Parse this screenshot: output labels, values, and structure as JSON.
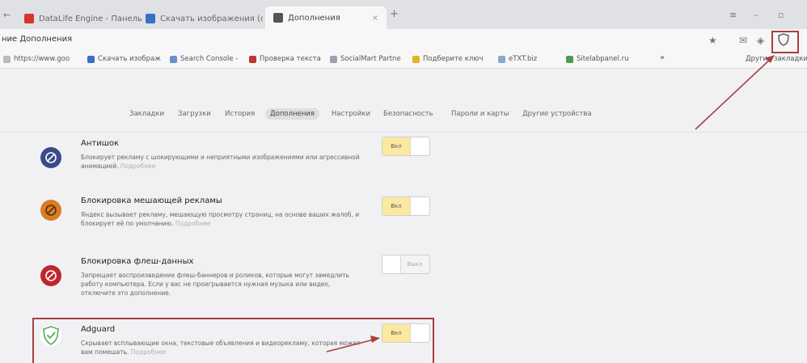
{
  "tabs": [
    {
      "label": "DataLife Engine - Панель",
      "fav_color": "#d9362b"
    },
    {
      "label": "Скачать изображения (скрин",
      "fav_color": "#3a6fc7"
    },
    {
      "label": "Дополнения",
      "fav_color": "#555555"
    }
  ],
  "tab_new": "+",
  "tab_close": "×",
  "window": {
    "menu": "≡",
    "minimize": "–",
    "maximize": "▫"
  },
  "address": {
    "text": "ние Дополнения"
  },
  "bookmarks": [
    {
      "label": "https://www.goo",
      "color": "#bbbbbb"
    },
    {
      "label": "Скачать изображ",
      "color": "#3a6fc7"
    },
    {
      "label": "Search Console -",
      "color": "#6a8fd1"
    },
    {
      "label": "Проверка текста",
      "color": "#c2362e"
    },
    {
      "label": "SocialMart Partne",
      "color": "#9aa3b0"
    },
    {
      "label": "Подберите ключ",
      "color": "#e6b229"
    },
    {
      "label": "eTXT.biz",
      "color": "#8aa8c8"
    },
    {
      "label": "Sitelabpanel.ru",
      "color": "#4e9a55"
    }
  ],
  "bookmarks_more": "»",
  "bookmarks_other": "Другие закладки",
  "nav": [
    "Закладки",
    "Загрузки",
    "История",
    "Дополнения",
    "Настройки",
    "Безопасность",
    "Пароли и карты",
    "Другие устройства"
  ],
  "extensions": [
    {
      "title": "Антишок",
      "desc": "Блокирует рекламу с шокирующими и неприятными изображениями или агрессивной анимацией.",
      "more": "Подробнее",
      "toggle": "Вкл",
      "on": true,
      "icon_color": "#3b4a8c"
    },
    {
      "title": "Блокировка мешающей рекламы",
      "desc": "Яндекс вызывает рекламу, мешающую просмотру страниц, на основе ваших жалоб, и блокирует её по умолчанию.",
      "more": "Подробнее",
      "toggle": "Вкл",
      "on": true,
      "icon_color": "#d77e22"
    },
    {
      "title": "Блокировка флеш-данных",
      "desc": "Запрещает воспроизведение флеш-баннеров и роликов, которые могут замедлить работу компьютера. Если у вас не проигрывается нужная музыка или видео, отключите это дополнение.",
      "more": "",
      "toggle": "Выкл",
      "on": false,
      "icon_color": "#c0272d"
    },
    {
      "title": "Adguard",
      "desc": "Скрывает всплывающие окна, текстовые объявления и видеорекламу, которая может вам помешать.",
      "more": "Подробнее",
      "toggle": "Вкл",
      "on": true,
      "icon_color": "#5aa85f"
    }
  ],
  "colors": {
    "highlight": "#a8403e",
    "toggle_on": "#fbe9a1"
  }
}
